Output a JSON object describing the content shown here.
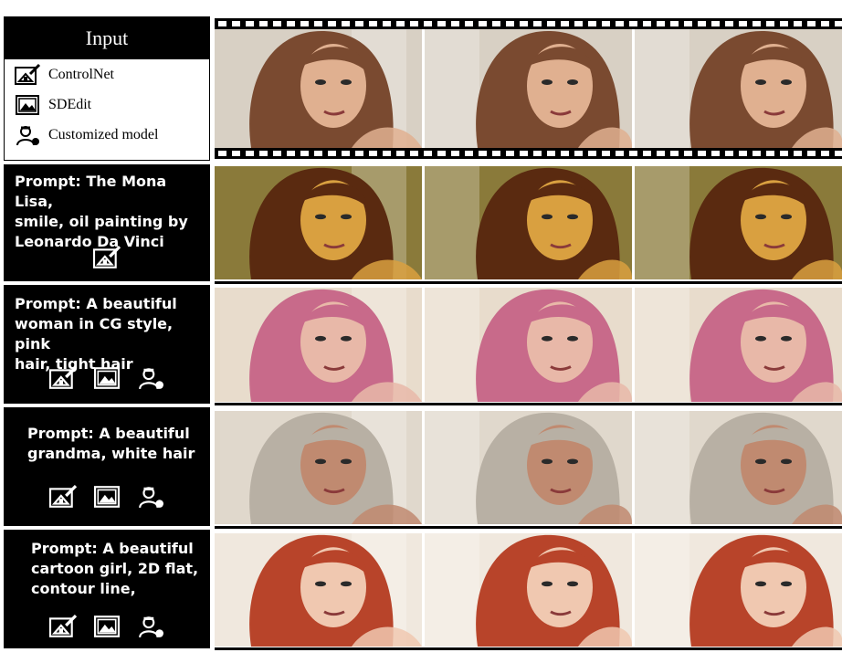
{
  "legend": {
    "title": "Input",
    "items": [
      {
        "label": "ControlNet",
        "icon": "controlnet-icon"
      },
      {
        "label": "SDEdit",
        "icon": "sdedit-icon"
      },
      {
        "label": "Customized model",
        "icon": "customized-model-icon"
      }
    ]
  },
  "rows": [
    {
      "prompt": "Prompt: The Mona Lisa,\nsmile, oil painting by\nLeonardo Da Vinci",
      "methods": [
        "controlnet-icon"
      ],
      "palette": {
        "bg": "#8a7a3a",
        "hair": "#5a2a10",
        "skin": "#d9a040"
      }
    },
    {
      "prompt": "Prompt: A beautiful\nwoman in CG style, pink\nhair, tight hair",
      "methods": [
        "controlnet-icon",
        "sdedit-icon",
        "customized-model-icon"
      ],
      "palette": {
        "bg": "#e8dccc",
        "hair": "#c86a8a",
        "skin": "#e8b8a8"
      }
    },
    {
      "prompt": "Prompt: A beautiful\ngrandma, white hair",
      "methods": [
        "controlnet-icon",
        "sdedit-icon",
        "customized-model-icon"
      ],
      "palette": {
        "bg": "#e0d8cc",
        "hair": "#b8b0a4",
        "skin": "#c08a70"
      }
    },
    {
      "prompt": "Prompt: A beautiful\ncartoon girl, 2D flat,\ncontour line,",
      "methods": [
        "controlnet-icon",
        "sdedit-icon",
        "customized-model-icon"
      ],
      "palette": {
        "bg": "#f0e8de",
        "hair": "#b8442a",
        "skin": "#f0c8b0"
      }
    }
  ],
  "input_palette": {
    "bg": "#d8d0c4",
    "hair": "#7a4a30",
    "skin": "#e0b090"
  }
}
